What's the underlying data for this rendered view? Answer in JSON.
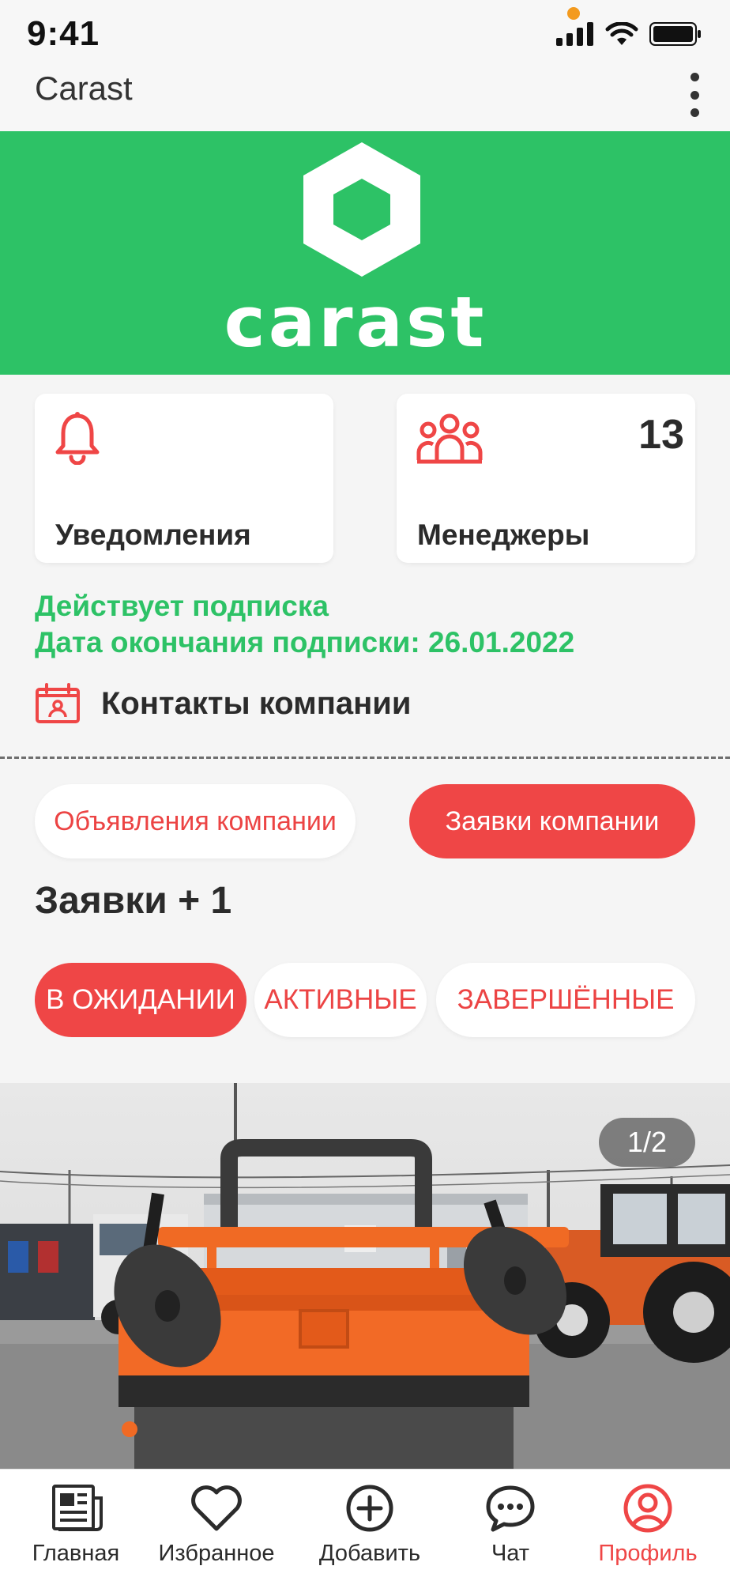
{
  "status": {
    "time": "9:41"
  },
  "app_bar": {
    "title": "Carast"
  },
  "banner": {
    "brand": "carast"
  },
  "cards": [
    {
      "label": "Уведомления",
      "icon": "bell-icon"
    },
    {
      "label": "Менеджеры",
      "icon": "users-icon",
      "count": "13"
    }
  ],
  "subscription": {
    "status": "Действует подписка",
    "end_date": "Дата окончания подписки: 26.01.2022"
  },
  "contacts": {
    "label": "Контакты компании",
    "icon": "contact-card-icon"
  },
  "switch": {
    "ads_label": "Объявления компании",
    "orders_label": "Заявки компании"
  },
  "section": {
    "title": "Заявки + 1"
  },
  "tabs": [
    {
      "label": "В ОЖИДАНИИ",
      "active": true
    },
    {
      "label": "АКТИВНЫЕ",
      "active": false
    },
    {
      "label": "ЗАВЕРШЁННЫЕ",
      "active": false
    }
  ],
  "photo": {
    "counter": "1/2"
  },
  "bottom_nav": [
    {
      "label": "Главная",
      "icon": "newspaper-icon"
    },
    {
      "label": "Избранное",
      "icon": "heart-icon"
    },
    {
      "label": "Добавить",
      "icon": "plus-circle-icon"
    },
    {
      "label": "Чат",
      "icon": "chat-icon"
    },
    {
      "label": "Профиль",
      "icon": "profile-icon",
      "active": true
    }
  ],
  "colors": {
    "brand_green": "#2dc266",
    "accent_red": "#ef4646",
    "background": "#f5f5f5"
  }
}
